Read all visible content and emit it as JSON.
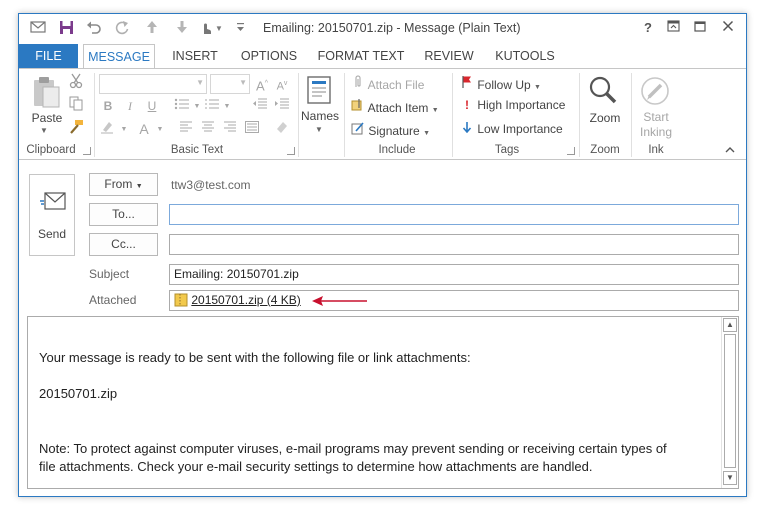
{
  "window": {
    "title": "Emailing: 20150701.zip - Message (Plain Text)"
  },
  "quick_access": {
    "save_icon": "save-icon",
    "undo_icon": "undo-icon",
    "redo_icon": "redo-icon",
    "up_icon": "up-arrow-icon",
    "down_icon": "down-arrow-icon",
    "touch_icon": "touch-mode-icon",
    "customize_icon": "customize-chevron-icon"
  },
  "window_controls": {
    "help": "?",
    "restore_ribbon": "⧉",
    "maximize": "☐",
    "close": "✕"
  },
  "tabs": [
    {
      "label": "FILE"
    },
    {
      "label": "MESSAGE"
    },
    {
      "label": "INSERT"
    },
    {
      "label": "OPTIONS"
    },
    {
      "label": "FORMAT TEXT"
    },
    {
      "label": "REVIEW"
    },
    {
      "label": "KUTOOLS"
    }
  ],
  "ribbon": {
    "clipboard": {
      "label": "Clipboard",
      "paste": "Paste"
    },
    "basic_text": {
      "label": "Basic Text"
    },
    "names": {
      "label": "Names",
      "button": "Names"
    },
    "include": {
      "label": "Include",
      "attach_file": "Attach File",
      "attach_item": "Attach Item",
      "signature": "Signature"
    },
    "tags": {
      "label": "Tags",
      "follow_up": "Follow Up",
      "high_importance": "High Importance",
      "low_importance": "Low Importance"
    },
    "zoom": {
      "label": "Zoom",
      "button": "Zoom"
    },
    "ink": {
      "label": "Ink",
      "button_line1": "Start",
      "button_line2": "Inking"
    }
  },
  "compose": {
    "send_label": "Send",
    "from_label": "From",
    "from_value": "ttw3@test.com",
    "to_label": "To...",
    "to_value": "",
    "cc_label": "Cc...",
    "cc_value": "",
    "subject_label": "Subject",
    "subject_value": "Emailing: 20150701.zip",
    "attached_label": "Attached",
    "attachment": "20150701.zip (4 KB)"
  },
  "body": {
    "line1": "Your message is ready to be sent with the following file or link attachments:",
    "line2": "20150701.zip",
    "line3": "Note: To protect against computer viruses, e-mail programs may prevent sending or receiving certain types of",
    "line4": "file attachments.  Check your e-mail security settings to determine how attachments are handled."
  },
  "colors": {
    "accent": "#2b79c2",
    "annotation_arrow": "#c8102e"
  }
}
